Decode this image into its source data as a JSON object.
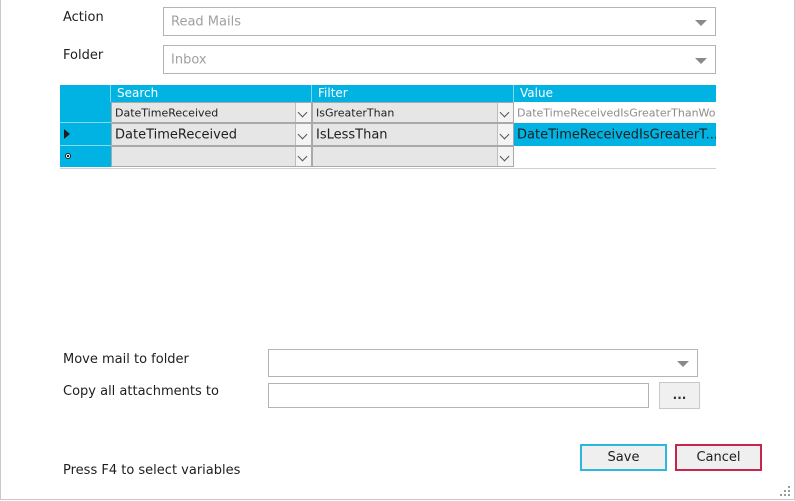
{
  "action": {
    "label": "Action",
    "value": "Read Mails"
  },
  "folder": {
    "label": "Folder",
    "value": "Inbox"
  },
  "grid": {
    "headers": {
      "search": "Search",
      "filter": "Filter",
      "value": "Value"
    },
    "rows": [
      {
        "search": "DateTimeReceived",
        "filter": "IsGreaterThan",
        "value": "DateTimeReceivedIsGreaterThanWor..."
      },
      {
        "search": "DateTimeReceived",
        "filter": "IsLessThan",
        "value": "DateTimeReceivedIsGreaterT..."
      }
    ]
  },
  "move_mail": {
    "label": "Move mail to folder",
    "value": ""
  },
  "copy_attachments": {
    "label": "Copy all attachments to",
    "value": "",
    "browse_label": "..."
  },
  "hint": "Press F4 to select variables",
  "buttons": {
    "save": "Save",
    "cancel": "Cancel"
  },
  "colors": {
    "accent": "#00b3e3",
    "save_border": "#2cb7dd",
    "cancel_border": "#c8244f"
  }
}
